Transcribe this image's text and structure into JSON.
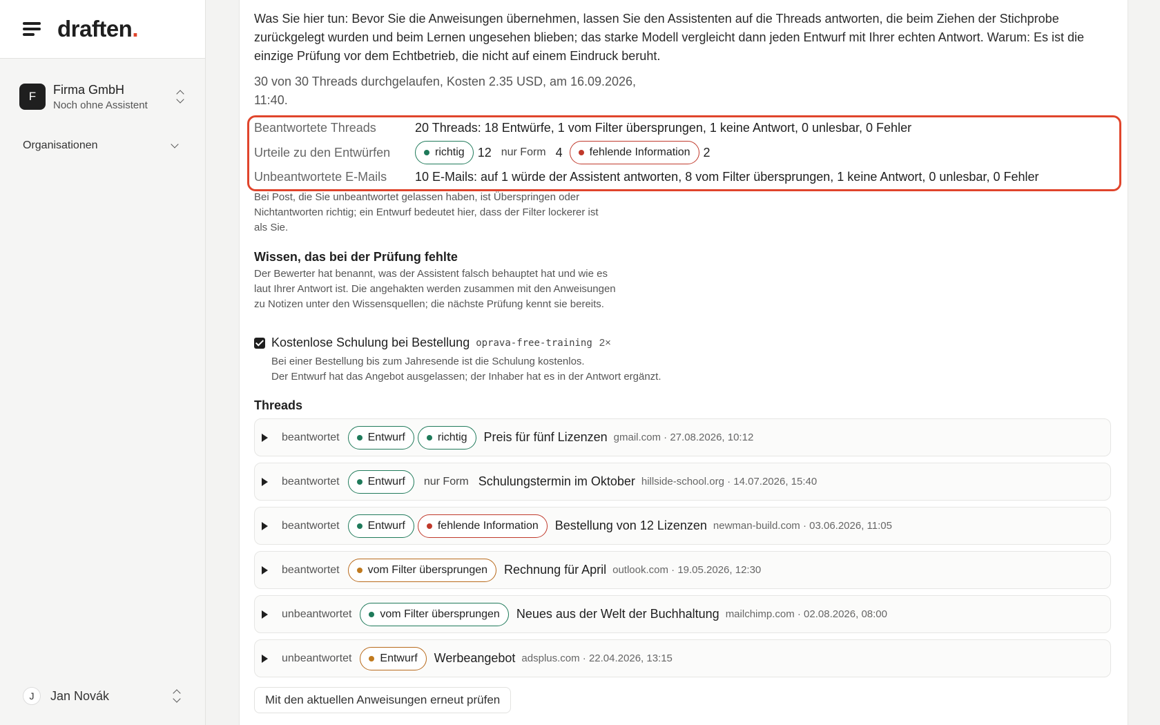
{
  "sidebar": {
    "logo_text": "draften",
    "logo_dot": ".",
    "org": {
      "initial": "F",
      "name": "Firma GmbH",
      "subtitle": "Noch ohne Assistent"
    },
    "organisations_label": "Organisationen",
    "user": {
      "initial": "J",
      "name": "Jan Novák"
    }
  },
  "main": {
    "intro": "Was Sie hier tun: Bevor Sie die Anweisungen übernehmen, lassen Sie den Assistenten auf die Threads antworten, die beim Ziehen der Stichprobe zurückgelegt wurden und beim Lernen ungesehen blieben; das starke Modell vergleicht dann jeden Entwurf mit Ihrer echten Antwort. Warum: Es ist die einzige Prüfung vor dem Echtbetrieb, die nicht auf einem Eindruck beruht.",
    "run_info": "30 von 30 Threads durchgelaufen, Kosten 2.35 USD, am 16.09.2026, 11:40.",
    "stats": {
      "answered_label": "Beantwortete Threads",
      "answered_value": "20 Threads: 18 Entwürfe, 1 vom Filter übersprungen, 1 keine Antwort, 0 unlesbar, 0 Fehler",
      "verdicts_label": "Urteile zu den Entwürfen",
      "verdict_correct_label": "richtig",
      "verdict_correct_count": "12",
      "verdict_form_label": "nur Form",
      "verdict_form_count": "4",
      "verdict_missing_label": "fehlende Information",
      "verdict_missing_count": "2",
      "unanswered_label": "Unbeantwortete E-Mails",
      "unanswered_value": "10 E-Mails: auf 1 würde der Assistent antworten, 8 vom Filter übersprungen, 1 keine Antwort, 0 unlesbar, 0 Fehler"
    },
    "note": "Bei Post, die Sie unbeantwortet gelassen haben, ist Überspringen oder Nichtantworten richtig; ein Entwurf bedeutet hier, dass der Filter lockerer ist als Sie.",
    "knowledge": {
      "heading": "Wissen, das bei der Prüfung fehlte",
      "description": "Der Bewerter hat benannt, was der Assistent falsch behauptet hat und wie es laut Ihrer Antwort ist. Die angehakten werden zusammen mit den Anweisungen zu Notizen unter den Wissensquellen; die nächste Prüfung kennt sie bereits.",
      "item": {
        "title": "Kostenlose Schulung bei Bestellung",
        "code": "oprava-free-training",
        "count": "2×",
        "line1": "Bei einer Bestellung bis zum Jahresende ist die Schulung kostenlos.",
        "line2": "Der Entwurf hat das Angebot ausgelassen; der Inhaber hat es in der Antwort ergänzt."
      }
    },
    "threads_heading": "Threads",
    "threads": [
      {
        "status": "beantwortet",
        "tag1": "Entwurf",
        "tag2": "richtig",
        "subject": "Preis für fünf Lizenzen",
        "meta": "gmail.com · 27.08.2026, 10:12"
      },
      {
        "status": "beantwortet",
        "tag1": "Entwurf",
        "tag2": "nur Form",
        "subject": "Schulungstermin im Oktober",
        "meta": "hillside-school.org · 14.07.2026, 15:40"
      },
      {
        "status": "beantwortet",
        "tag1": "Entwurf",
        "tag2": "fehlende Information",
        "subject": "Bestellung von 12 Lizenzen",
        "meta": "newman-build.com · 03.06.2026, 11:05"
      },
      {
        "status": "beantwortet",
        "tag1": "vom Filter übersprungen",
        "subject": "Rechnung für April",
        "meta": "outlook.com · 19.05.2026, 12:30"
      },
      {
        "status": "unbeantwortet",
        "tag1": "vom Filter übersprungen",
        "subject": "Neues aus der Welt der Buchhaltung",
        "meta": "mailchimp.com · 02.08.2026, 08:00"
      },
      {
        "status": "unbeantwortet",
        "tag1": "Entwurf",
        "subject": "Werbeangebot",
        "meta": "adsplus.com · 22.04.2026, 13:15"
      }
    ],
    "recheck_button": "Mit den aktuellen Anweisungen erneut prüfen"
  },
  "colors": {
    "accent": "#e0452c",
    "green": "#1f7a5a",
    "red": "#c0392b",
    "orange": "#c07a1f"
  }
}
